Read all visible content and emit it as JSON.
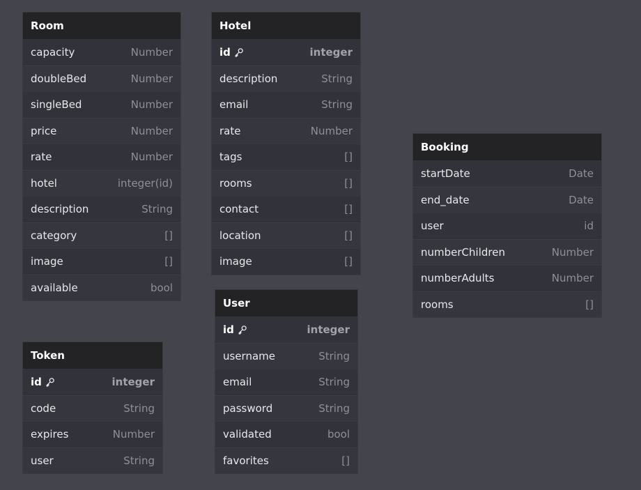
{
  "tables": {
    "room": {
      "title": "Room",
      "fields": [
        {
          "name": "capacity",
          "type": "Number"
        },
        {
          "name": "doubleBed",
          "type": "Number"
        },
        {
          "name": "singleBed",
          "type": "Number"
        },
        {
          "name": "price",
          "type": "Number"
        },
        {
          "name": "rate",
          "type": "Number"
        },
        {
          "name": "hotel",
          "type": "integer(id)"
        },
        {
          "name": "description",
          "type": "String"
        },
        {
          "name": "category",
          "type": "[]"
        },
        {
          "name": "image",
          "type": "[]"
        },
        {
          "name": "available",
          "type": "bool"
        }
      ]
    },
    "hotel": {
      "title": "Hotel",
      "fields": [
        {
          "name": "id",
          "type": "integer",
          "primary_key": true
        },
        {
          "name": "description",
          "type": "String"
        },
        {
          "name": "email",
          "type": "String"
        },
        {
          "name": "rate",
          "type": "Number"
        },
        {
          "name": "tags",
          "type": "[]"
        },
        {
          "name": "rooms",
          "type": "[]"
        },
        {
          "name": "contact",
          "type": "[]"
        },
        {
          "name": "location",
          "type": "[]"
        },
        {
          "name": "image",
          "type": "[]"
        }
      ]
    },
    "booking": {
      "title": "Booking",
      "fields": [
        {
          "name": "startDate",
          "type": "Date"
        },
        {
          "name": "end_date",
          "type": "Date"
        },
        {
          "name": "user",
          "type": "id"
        },
        {
          "name": "numberChildren",
          "type": "Number"
        },
        {
          "name": "numberAdults",
          "type": "Number"
        },
        {
          "name": "rooms",
          "type": "[]"
        }
      ]
    },
    "user": {
      "title": "User",
      "fields": [
        {
          "name": "id",
          "type": "integer",
          "primary_key": true
        },
        {
          "name": "username",
          "type": "String"
        },
        {
          "name": "email",
          "type": "String"
        },
        {
          "name": "password",
          "type": "String"
        },
        {
          "name": "validated",
          "type": "bool"
        },
        {
          "name": "favorites",
          "type": "[]"
        }
      ]
    },
    "token": {
      "title": "Token",
      "fields": [
        {
          "name": "id",
          "type": "integer",
          "primary_key": true
        },
        {
          "name": "code",
          "type": "String"
        },
        {
          "name": "expires",
          "type": "Number"
        },
        {
          "name": "user",
          "type": "String"
        }
      ]
    }
  },
  "icons": {
    "primary_key": "key-icon"
  },
  "colors": {
    "canvas_background": "#44444c",
    "table_header_background": "#232325",
    "table_body_background": "#32323a",
    "field_name_color": "#e8e8ec",
    "field_type_color": "#8f8f96"
  }
}
